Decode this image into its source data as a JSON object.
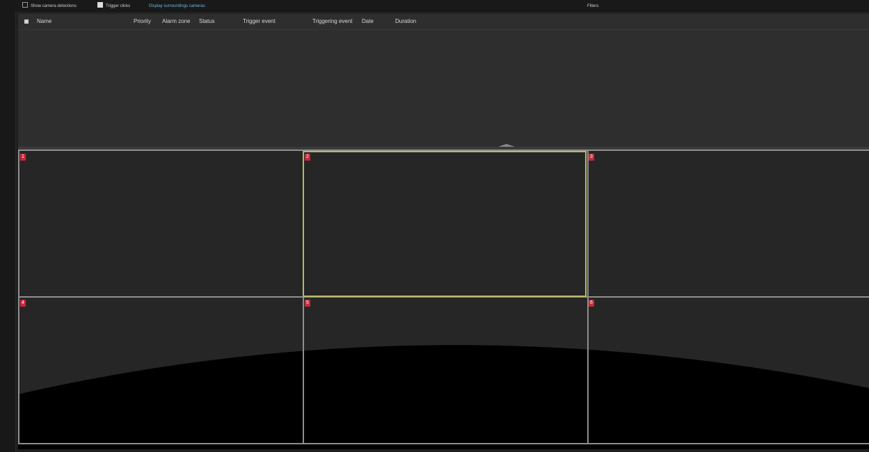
{
  "toolbar": {
    "items": [
      {
        "label": "Show camera detections",
        "checked": false
      },
      {
        "label": "Trigger clicks",
        "checked": true
      },
      {
        "label": "Display surroundings cameras",
        "link": true
      }
    ],
    "right_label": "Filters"
  },
  "list": {
    "columns": [
      "Name",
      "Priority",
      "Alarm zone",
      "Status",
      "Trigger event",
      "Triggering event",
      "Date",
      "Duration"
    ]
  },
  "grid": {
    "cells": [
      "1",
      "2",
      "3",
      "4",
      "5",
      "6"
    ],
    "selected_cell": "2"
  },
  "colors": {
    "background": "#262626",
    "selection": "#b8b86a",
    "cell_badge": "#c8283a",
    "link": "#6fb6e0"
  }
}
